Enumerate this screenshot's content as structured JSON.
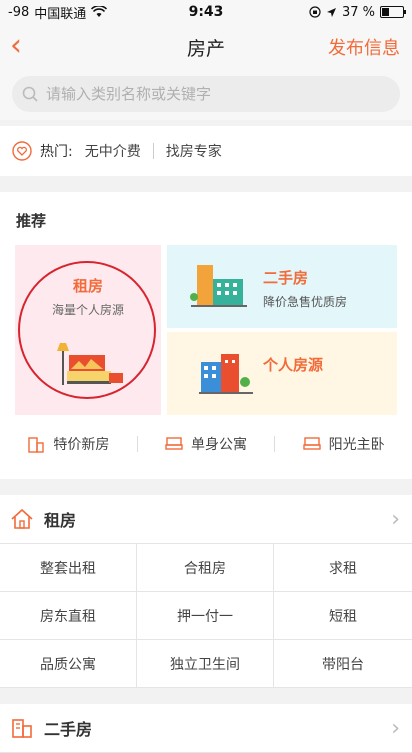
{
  "status": {
    "signal": "-98",
    "carrier": "中国联通",
    "time": "9:43",
    "battery_pct": "37 %",
    "battery_level": 0.37
  },
  "nav": {
    "back": "‹",
    "title": "房产",
    "publish": "发布信息"
  },
  "search": {
    "placeholder": "请输入类别名称或关键字"
  },
  "hot": {
    "label": "热门:",
    "items": [
      "无中介费",
      "找房专家"
    ]
  },
  "recommend": {
    "title": "推荐",
    "big": {
      "title": "租房",
      "subtitle": "海量个人房源"
    },
    "cards": [
      {
        "title": "二手房",
        "subtitle": "降价急售优质房"
      },
      {
        "title": "个人房源",
        "subtitle": ""
      }
    ],
    "links": [
      "特价新房",
      "单身公寓",
      "阳光主卧"
    ]
  },
  "sections": [
    {
      "title": "租房",
      "cells": [
        "整套出租",
        "合租房",
        "求租",
        "房东直租",
        "押一付一",
        "短租",
        "品质公寓",
        "独立卫生间",
        "带阳台"
      ]
    },
    {
      "title": "二手房"
    }
  ],
  "colors": {
    "accent": "#f26b3a",
    "pink": "#fde9ee",
    "cyan": "#e3f6f9",
    "cream": "#fff7e4",
    "annotation": "#d8242e"
  }
}
